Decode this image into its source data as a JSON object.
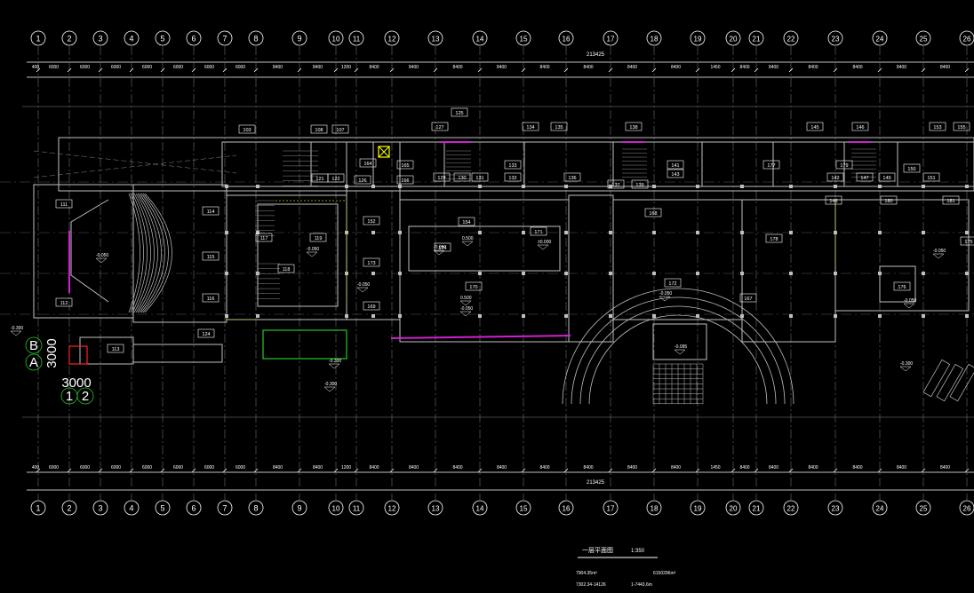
{
  "axis_labels_top": [
    "1",
    "2",
    "3",
    "4",
    "5",
    "6",
    "7",
    "8",
    "9",
    "10",
    "11",
    "12",
    "13",
    "14",
    "15",
    "16",
    "17",
    "18",
    "19",
    "20",
    "21",
    "22",
    "23",
    "24",
    "25",
    "26"
  ],
  "axis_labels_bottom": [
    "1",
    "2",
    "3",
    "4",
    "5",
    "6",
    "7",
    "8",
    "9",
    "10",
    "11",
    "12",
    "13",
    "14",
    "15",
    "16",
    "17",
    "18",
    "19",
    "20",
    "21",
    "22",
    "23",
    "24",
    "25",
    "26"
  ],
  "overall_dimension_top": "213425",
  "overall_dimension_bottom": "213425",
  "bay_dimensions_top": [
    "400",
    "6000",
    "6000",
    "6000",
    "6000",
    "6000",
    "6000",
    "6000",
    "8400",
    "8400",
    "1200",
    "8400",
    "8400",
    "8400",
    "8400",
    "8400",
    "8400",
    "8400",
    "8400",
    "1450",
    "8400",
    "8400",
    "8400",
    "8400",
    "8400",
    "8400"
  ],
  "bay_dimensions_bottom": [
    "400",
    "6000",
    "6000",
    "6000",
    "6000",
    "6000",
    "6000",
    "6000",
    "8400",
    "8400",
    "1200",
    "8400",
    "8400",
    "8400",
    "8400",
    "8400",
    "8400",
    "8400",
    "8400",
    "1450",
    "8400",
    "8400",
    "8400",
    "8400",
    "8400",
    "8400"
  ],
  "left_grid": {
    "row_b": "B",
    "row_a": "A",
    "dim_vertical": "3000",
    "dim_horizontal": "3000",
    "col_1": "1",
    "col_2": "2"
  },
  "room_numbers": [
    "103",
    "108",
    "107",
    "125",
    "127",
    "134",
    "135",
    "138",
    "145",
    "146",
    "153",
    "155",
    "111",
    "114",
    "115",
    "116",
    "112",
    "113",
    "117",
    "119",
    "118",
    "121",
    "122",
    "124",
    "164",
    "165",
    "166",
    "126",
    "129",
    "130",
    "131",
    "132",
    "133",
    "136",
    "137",
    "139",
    "141",
    "143",
    "148",
    "142",
    "147",
    "149",
    "150",
    "151",
    "152",
    "154",
    "173",
    "174",
    "171",
    "170",
    "169",
    "168",
    "172",
    "167",
    "175",
    "176",
    "177",
    "178",
    "179",
    "180",
    "181"
  ],
  "elevations": [
    "-0.050",
    "-0.050",
    "±0.000",
    "-0.050",
    "-0.050",
    "-0.050",
    "-0.050",
    "-0.050",
    "-0.050",
    "0.500",
    "0.500",
    "-0.300",
    "-0.300",
    "-0.300",
    "-0.300",
    "-0.095"
  ],
  "title_block": {
    "title": "一层平面图",
    "scale": "1:350"
  },
  "notes": [
    "7904.35m²",
    "6150296m²",
    "7302.34-14126",
    "1-7443.6m"
  ]
}
